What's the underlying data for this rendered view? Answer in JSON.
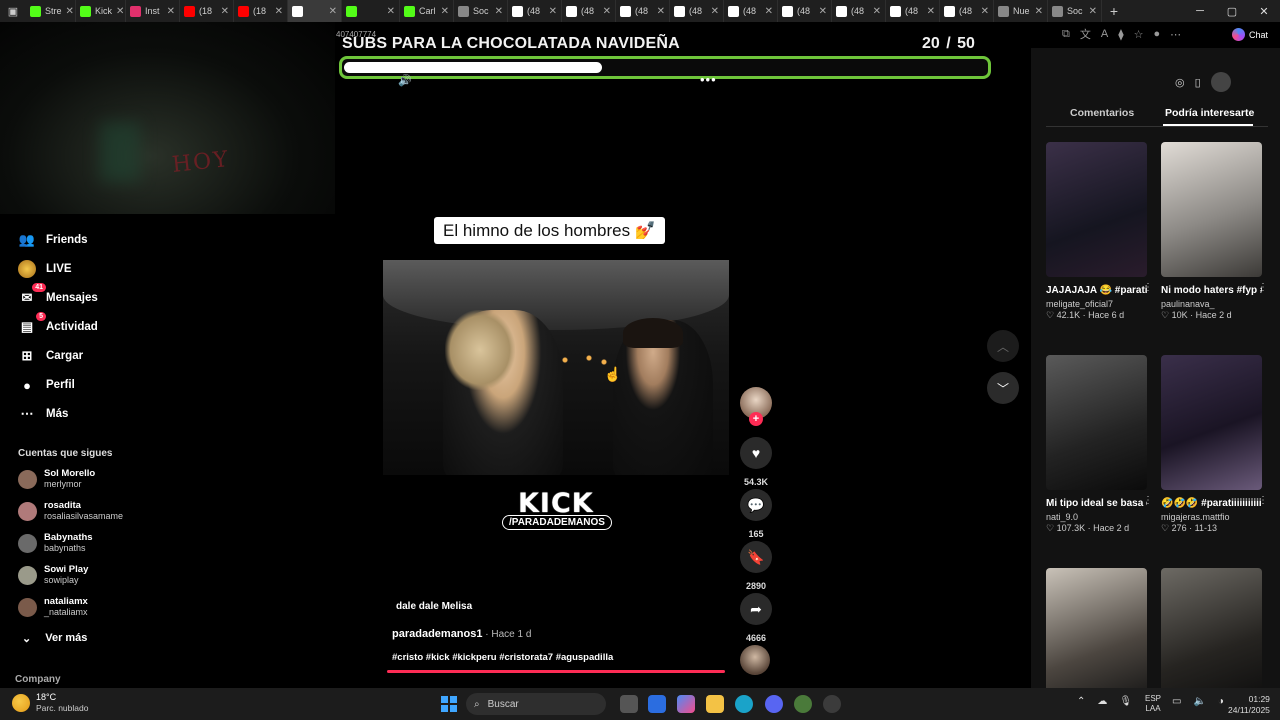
{
  "browser": {
    "tabs": [
      {
        "label": "Stre",
        "color": "#53fc18",
        "icon": "kick-icon"
      },
      {
        "label": "Kick",
        "color": "#53fc18",
        "icon": "kick-icon"
      },
      {
        "label": "Inst",
        "color": "#e1306c",
        "icon": "instagram-icon"
      },
      {
        "label": "(18",
        "color": "#ff0000",
        "icon": "youtube-icon"
      },
      {
        "label": "(18",
        "color": "#ff0000",
        "icon": "youtube-icon"
      },
      {
        "label": "",
        "color": "#ffffff",
        "icon": "tiktok-icon"
      },
      {
        "label": "",
        "color": "#53fc18",
        "icon": "kick-icon"
      },
      {
        "label": "Carl",
        "color": "#53fc18",
        "icon": "kick-icon"
      },
      {
        "label": "Soc",
        "color": "#888888",
        "icon": "page-icon"
      },
      {
        "label": "(48",
        "color": "#ffffff",
        "icon": "tiktok-icon"
      },
      {
        "label": "(48",
        "color": "#ffffff",
        "icon": "tiktok-icon"
      },
      {
        "label": "(48",
        "color": "#ffffff",
        "icon": "tiktok-icon"
      },
      {
        "label": "(48",
        "color": "#ffffff",
        "icon": "tiktok-icon"
      },
      {
        "label": "(48",
        "color": "#ffffff",
        "icon": "tiktok-icon"
      },
      {
        "label": "(48",
        "color": "#ffffff",
        "icon": "tiktok-icon"
      },
      {
        "label": "(48",
        "color": "#ffffff",
        "icon": "tiktok-icon"
      },
      {
        "label": "(48",
        "color": "#ffffff",
        "icon": "tiktok-icon"
      },
      {
        "label": "(48",
        "color": "#ffffff",
        "icon": "tiktok-icon"
      },
      {
        "label": "Nue",
        "color": "#888888",
        "icon": "page-icon"
      },
      {
        "label": "Soc",
        "color": "#888888",
        "icon": "page-icon"
      }
    ],
    "chat_label": "Chat"
  },
  "overlay": {
    "goal_title": "SUBS PARA LA CHOCOLATADA NAVIDEÑA",
    "goal_current": "20",
    "goal_total": "/ 50",
    "goal_progress": 0.4,
    "webcam_text": "HOY",
    "video_id": "407407774"
  },
  "sidebar": {
    "items": [
      {
        "label": "Friends",
        "icon": "friends-icon",
        "badge": ""
      },
      {
        "label": "LIVE",
        "icon": "live-icon",
        "badge": ""
      },
      {
        "label": "Mensajes",
        "icon": "messages-icon",
        "badge": "41"
      },
      {
        "label": "Actividad",
        "icon": "activity-icon",
        "badge": "5"
      },
      {
        "label": "Cargar",
        "icon": "upload-icon",
        "badge": ""
      },
      {
        "label": "Perfil",
        "icon": "profile-icon",
        "badge": ""
      },
      {
        "label": "Más",
        "icon": "more-icon",
        "badge": ""
      }
    ],
    "following_heading": "Cuentas que sigues",
    "following": [
      {
        "name": "Sol Morello",
        "handle": "merlymor"
      },
      {
        "name": "rosadita",
        "handle": "rosaliasilvasamame"
      },
      {
        "name": "Babynaths",
        "handle": "babynaths"
      },
      {
        "name": "Sowi Play",
        "handle": "sowiplay"
      },
      {
        "name": "nataliamx",
        "handle": "_nataliamx"
      }
    ],
    "see_more": "Ver más",
    "company": "Company"
  },
  "video": {
    "caption_overlay": "El himno de los hombres 💅",
    "kick_logo": "KICK",
    "kick_handle": "/PARADADEMANOS",
    "sound": "dale dale Melisa",
    "author": "parada​demanos1",
    "time_ago": " · Hace 1 d",
    "hashtags": "#cristo #kick #kickperu #cristorata7 #aguspadilla",
    "likes": "54.3K",
    "comments": "165",
    "saves": "2890",
    "shares": "4666"
  },
  "right_panel": {
    "tab_comments": "Comentarios",
    "tab_suggested": "Podría interesarte",
    "cards": [
      {
        "title": "JAJAJAJA 😂 #paratiiiiiiiiiiiiiiii...",
        "user": "meligate_oficial7",
        "views": "42.1K",
        "age": "Hace 6 d"
      },
      {
        "title": "Ni modo haters #fyp #parati #vir...",
        "user": "paulinanava_",
        "views": "10K",
        "age": "Hace 2 d"
      },
      {
        "title": "Mi tipo ideal se basa en ellos 🥵...",
        "user": "nati_9.0",
        "views": "107.3K",
        "age": "Hace 2 d"
      },
      {
        "title": "🤣🤣🤣 #paratiiiiiiiiiiiiiiii...",
        "user": "migajeras.mattfio",
        "views": "276",
        "age": "11-13"
      },
      {
        "title": "",
        "user": "",
        "views": "",
        "age": ""
      },
      {
        "title": "",
        "user": "",
        "views": "",
        "age": ""
      }
    ]
  },
  "taskbar": {
    "temp": "18°C",
    "condition": "Parc. nublado",
    "search_placeholder": "Buscar",
    "lang_1": "ESP",
    "lang_2": "LAA",
    "time": "01:29",
    "date": "24/11/2025"
  }
}
